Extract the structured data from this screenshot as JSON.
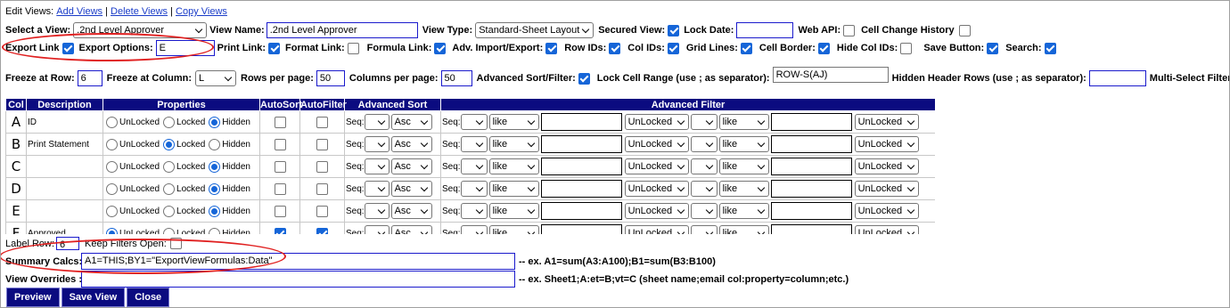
{
  "header": {
    "title": "Edit Views:",
    "links": [
      "Add Views",
      "Delete Views",
      "Copy Views"
    ]
  },
  "row1": {
    "select_view_label": "Select a View:",
    "select_view_value": ".2nd Level Approver",
    "view_name_label": "View Name:",
    "view_name_value": ".2nd Level Approver",
    "view_type_label": "View Type:",
    "view_type_value": "Standard-Sheet Layout",
    "secured_view_label": "Secured View:",
    "secured_view_checked": true,
    "lock_date_label": "Lock Date:",
    "lock_date_value": "",
    "web_api_label": "Web API:",
    "web_api_checked": false,
    "cell_change_history_label": "Cell Change History",
    "cell_change_history_checked": false
  },
  "row2": {
    "export_link_label": "Export Link",
    "export_link_checked": true,
    "export_options_label": "Export Options:",
    "export_options_value": "E",
    "checks": [
      {
        "label": "Print Link:",
        "checked": true
      },
      {
        "label": "Format Link:",
        "checked": false
      },
      {
        "label": "Formula Link:",
        "checked": true
      },
      {
        "label": "Adv. Import/Export:",
        "checked": true
      },
      {
        "label": "Row IDs:",
        "checked": true
      },
      {
        "label": "Col IDs:",
        "checked": true
      },
      {
        "label": "Grid Lines:",
        "checked": true
      },
      {
        "label": "Cell Border:",
        "checked": true
      },
      {
        "label": "Hide Col IDs:",
        "checked": false
      },
      {
        "label": "Save Button:",
        "checked": true
      },
      {
        "label": "Search:",
        "checked": true
      }
    ]
  },
  "row3": {
    "freeze_row_label": "Freeze at Row:",
    "freeze_row_value": "6",
    "freeze_col_label": "Freeze at Column:",
    "freeze_col_value": "L",
    "rows_per_page_label": "Rows per page:",
    "rows_per_page_value": "50",
    "cols_per_page_label": "Columns per page:",
    "cols_per_page_value": "50",
    "adv_sort_filter_label": "Advanced Sort/Filter:",
    "adv_sort_filter_checked": true,
    "lock_cell_range_label": "Lock Cell Range (use ; as separator):",
    "lock_cell_range_value": "ROW-S(AJ)",
    "hidden_header_rows_label": "Hidden Header Rows (use ; as separator):",
    "hidden_header_rows_value": "",
    "multi_select_label": "Multi-Select Filters:",
    "multi_select_checked": true
  },
  "table": {
    "headers": [
      "Col",
      "Description",
      "Properties",
      "AutoSort",
      "AutoFilter",
      "Advanced Sort",
      "Advanced Filter"
    ],
    "radio_labels": [
      "UnLocked",
      "Locked",
      "Hidden"
    ],
    "seq_label": "Seq:",
    "sort_default": "Asc",
    "like_default": "like",
    "lock_default": "UnLocked",
    "rows": [
      {
        "col": "A",
        "desc": "ID",
        "prop": "Hidden",
        "autosort": false,
        "autofilter": false
      },
      {
        "col": "B",
        "desc": "Print Statement",
        "prop": "Locked",
        "autosort": false,
        "autofilter": false
      },
      {
        "col": "C",
        "desc": "",
        "prop": "Hidden",
        "autosort": false,
        "autofilter": false
      },
      {
        "col": "D",
        "desc": "",
        "prop": "Hidden",
        "autosort": false,
        "autofilter": false
      },
      {
        "col": "E",
        "desc": "",
        "prop": "Hidden",
        "autosort": false,
        "autofilter": false
      },
      {
        "col": "F",
        "desc": "Approved",
        "prop": "UnLocked",
        "autosort": true,
        "autofilter": true
      }
    ]
  },
  "bottom": {
    "label_row_label": "Label Row:",
    "label_row_value": "6",
    "keep_filters_label": "Keep Filters Open:",
    "keep_filters_checked": false,
    "summary_calcs_label": "Summary Calcs:",
    "summary_calcs_value": "A1=THIS;BY1=\"ExportViewFormulas:Data\"",
    "summary_calcs_hint": "-- ex. A1=sum(A3:A100);B1=sum(B3:B100)",
    "view_overrides_label": "View Overrides :",
    "view_overrides_value": "",
    "view_overrides_hint": "-- ex. Sheet1;A:et=B;vt=C (sheet name;email col:property=column;etc.)"
  },
  "buttons": [
    "Preview",
    "Save View",
    "Close"
  ],
  "colors": {
    "header_bg": "#0b0b80",
    "link": "#1a3cc8",
    "check": "#1565d8",
    "annotation": "#e02020"
  }
}
